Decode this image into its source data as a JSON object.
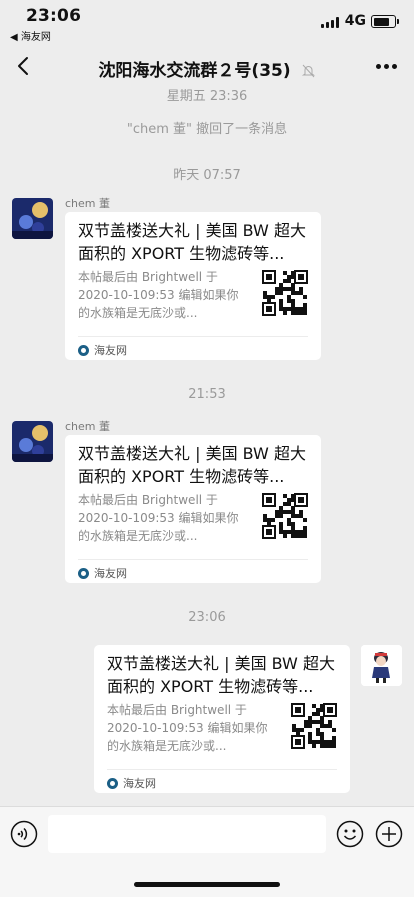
{
  "status_bar": {
    "time": "23:06",
    "back_app": "◀ 海友网",
    "network": "4G",
    "battery_level": 0.85
  },
  "nav": {
    "title": "沈阳海水交流群２号(35)"
  },
  "system": {
    "top_time": "星期五 23:36",
    "recall": "\"chem 董\" 撤回了一条消息",
    "time_1": "昨天 07:57",
    "time_2": "21:53",
    "time_3": "23:06"
  },
  "messages": [
    {
      "sender": "chem 董",
      "title": "双节盖楼送大礼 | 美国 BW 超大面积的 XPORT 生物滤砖等...",
      "desc": "本帖最后由 Brightwell 于 2020-10-109:53 编辑如果你的水族箱是无底沙或...",
      "source": "海友网"
    },
    {
      "sender": "chem 董",
      "title": "双节盖楼送大礼 | 美国 BW 超大面积的 XPORT 生物滤砖等...",
      "desc": "本帖最后由 Brightwell 于 2020-10-109:53 编辑如果你的水族箱是无底沙或...",
      "source": "海友网"
    },
    {
      "sender": "",
      "title": "双节盖楼送大礼 | 美国 BW 超大面积的 XPORT 生物滤砖等...",
      "desc": "本帖最后由 Brightwell 于 2020-10-109:53 编辑如果你的水族箱是无底沙或...",
      "source": "海友网"
    }
  ],
  "icons": {
    "back": "chevron-left-icon",
    "mute": "bell-off-icon",
    "more": "more-dots-icon",
    "voice": "voice-icon",
    "emoji": "emoji-icon",
    "plus": "plus-icon",
    "source": "site-logo-icon"
  },
  "colors": {
    "background": "#ededed",
    "card": "#ffffff",
    "system_text": "#9a9a9a",
    "source_logo": "#1b5f86"
  }
}
